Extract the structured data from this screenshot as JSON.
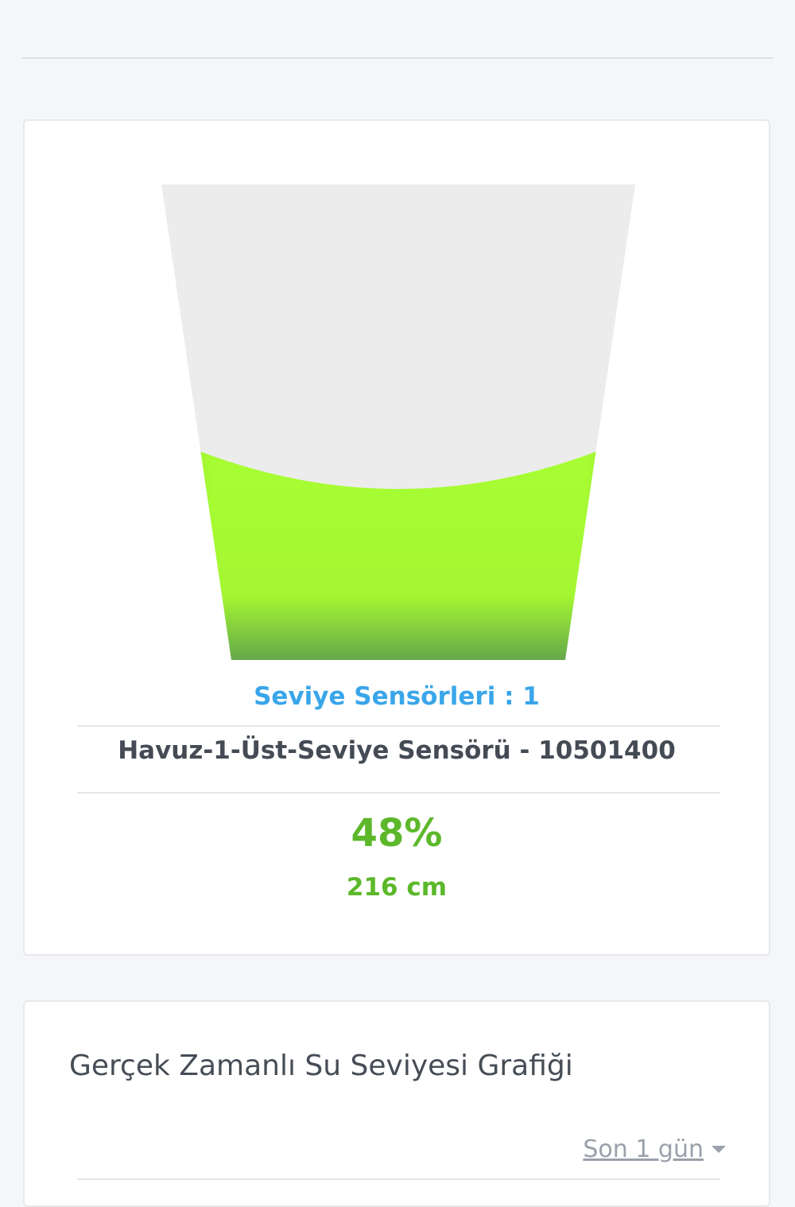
{
  "tank": {
    "level_fraction": 0.48,
    "fill_color": "#a8ff33",
    "empty_color": "#ececec"
  },
  "sensor_panel": {
    "count_label": "Seviye Sensörleri : 1",
    "sensor_name": "Havuz-1-Üst-Seviye Sensörü - 10501400",
    "level_percent": "48%",
    "level_cm": "216 cm"
  },
  "chart_panel": {
    "title": "Gerçek Zamanlı Su Seviyesi Grafiği",
    "range_select": "Son 1 gün"
  },
  "colors": {
    "accent_blue": "#3aa6ea",
    "level_green": "#5cb82a"
  }
}
